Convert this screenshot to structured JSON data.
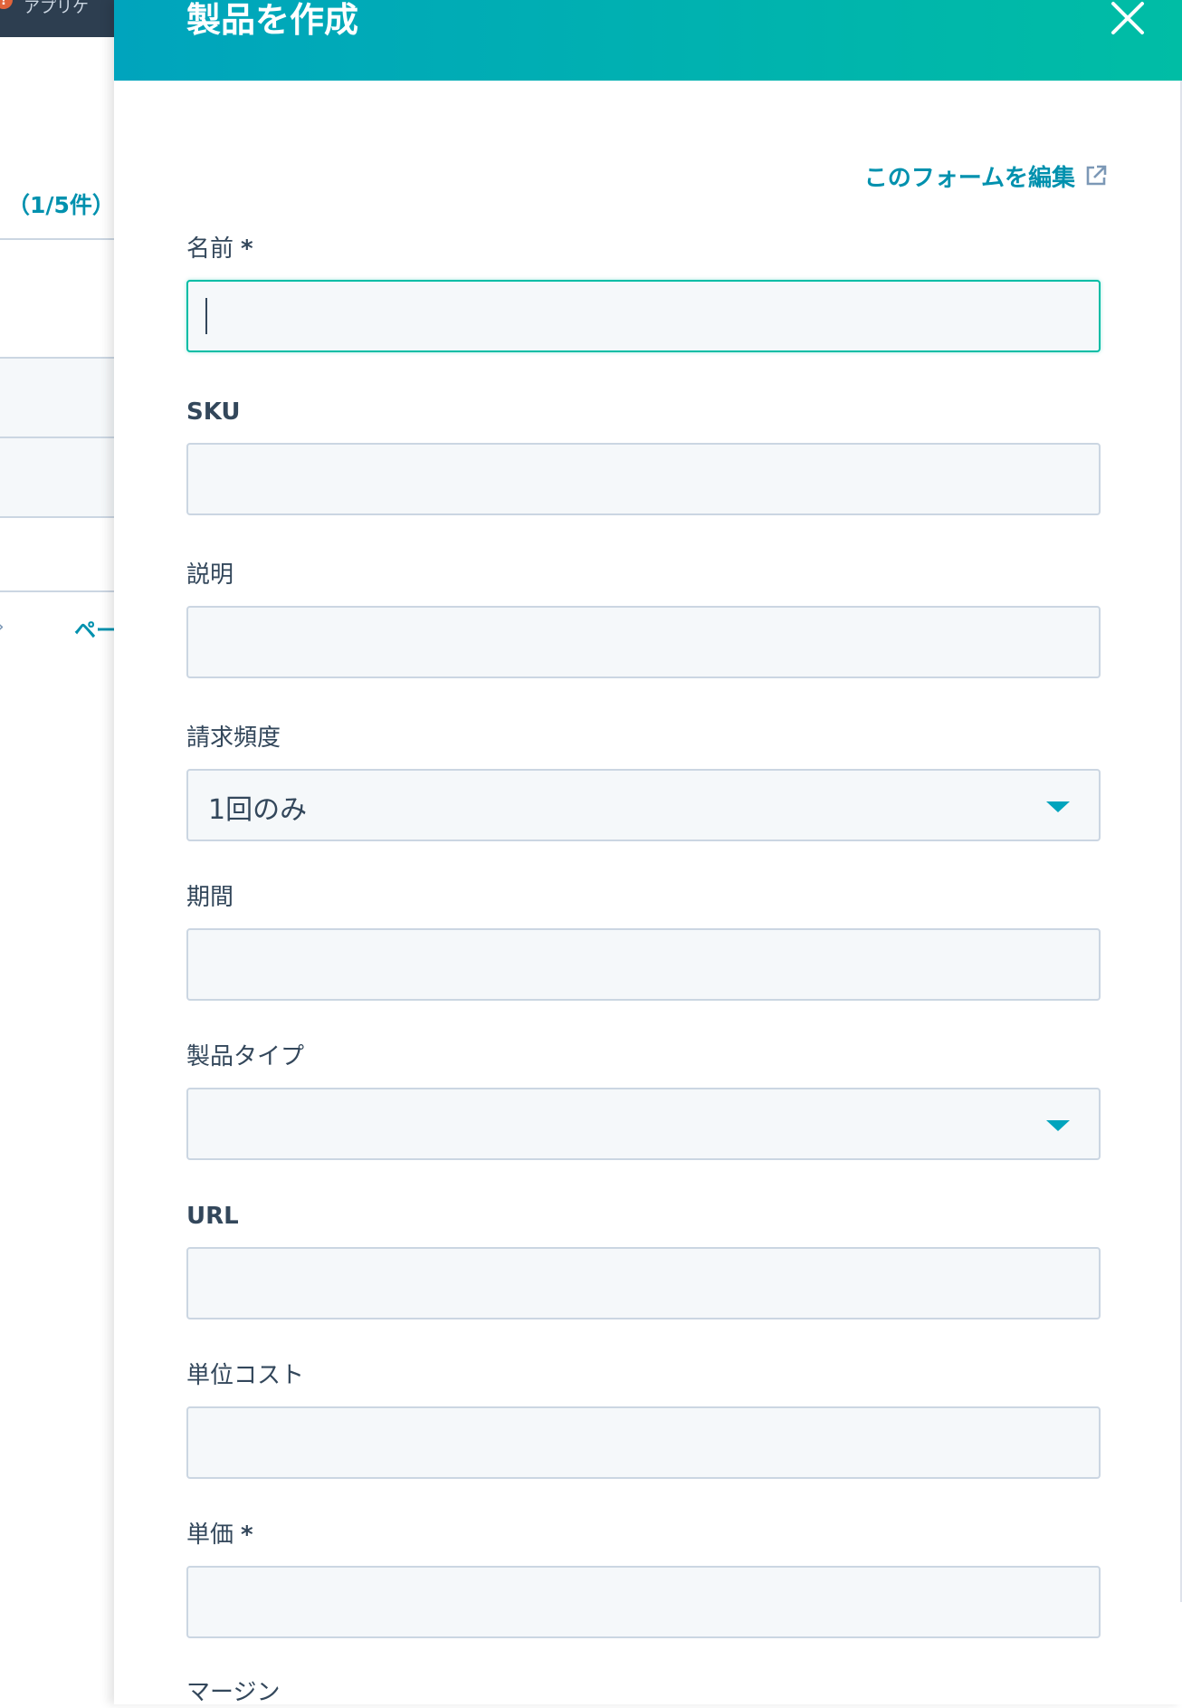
{
  "background": {
    "topbar_text": "アプリケ",
    "alert_badge": "!",
    "record_count": "（1/5件）",
    "page_link": "ペー"
  },
  "panel": {
    "title": "製品を作成",
    "close_icon": "close-icon",
    "edit_form_link": "このフォームを編集",
    "external_link_icon": "external-link-icon",
    "accent_color": "#00a4bd",
    "header_gradient": [
      "#00a4bd",
      "#00bda5"
    ]
  },
  "fields": {
    "name": {
      "label": "名前",
      "required_mark": "*",
      "value": "",
      "focused": true
    },
    "sku": {
      "label": "SKU",
      "value": ""
    },
    "description": {
      "label": "説明",
      "value": ""
    },
    "billing_frequency": {
      "label": "請求頻度",
      "selected": "1回のみ"
    },
    "term": {
      "label": "期間",
      "value": ""
    },
    "product_type": {
      "label": "製品タイプ",
      "selected": ""
    },
    "url": {
      "label": "URL",
      "value": ""
    },
    "unit_cost": {
      "label": "単位コスト",
      "value": ""
    },
    "unit_price": {
      "label": "単価",
      "required_mark": "*",
      "value": ""
    },
    "margin": {
      "label": "マージン"
    }
  }
}
